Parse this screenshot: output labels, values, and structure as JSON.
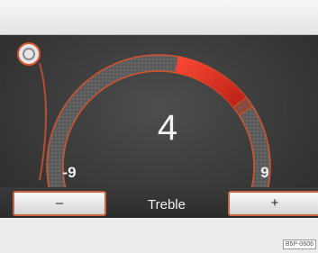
{
  "gauge": {
    "value": "4",
    "value_number": 4,
    "min_label": "-9",
    "max_label": "9",
    "min": -9,
    "max": 9,
    "accent_color": "#e03a2a",
    "track_color": "#d7542f"
  },
  "controls": {
    "minus_label": "–",
    "setting_label": "Treble",
    "plus_label": "+"
  },
  "left_knob": {
    "icon": "rotary-knob-icon"
  },
  "figure_code": "B5P-0606"
}
